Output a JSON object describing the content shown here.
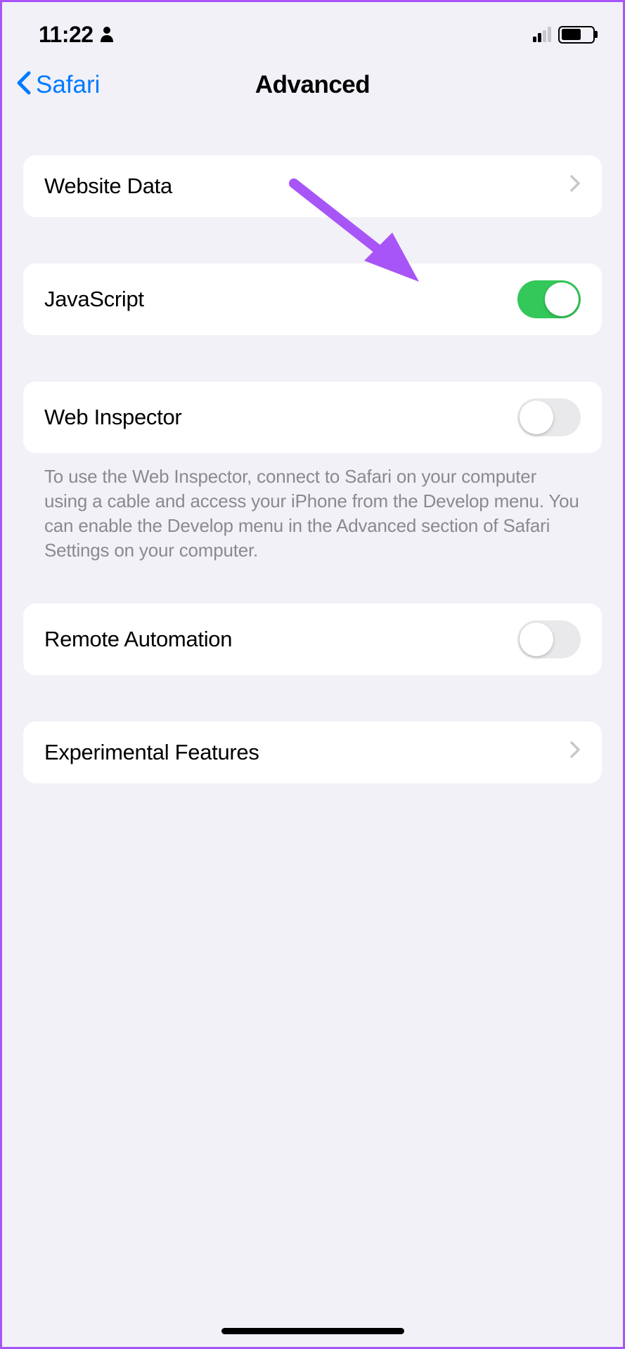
{
  "status_bar": {
    "time": "11:22"
  },
  "nav": {
    "back_label": "Safari",
    "title": "Advanced"
  },
  "rows": {
    "website_data": {
      "label": "Website Data"
    },
    "javascript": {
      "label": "JavaScript",
      "enabled": true
    },
    "web_inspector": {
      "label": "Web Inspector",
      "enabled": false
    },
    "web_inspector_footer": "To use the Web Inspector, connect to Safari on your computer using a cable and access your iPhone from the Develop menu. You can enable the Develop menu in the Advanced section of Safari Settings on your computer.",
    "remote_automation": {
      "label": "Remote Automation",
      "enabled": false
    },
    "experimental_features": {
      "label": "Experimental Features"
    }
  },
  "annotation": {
    "arrow_color": "#a855f7"
  }
}
